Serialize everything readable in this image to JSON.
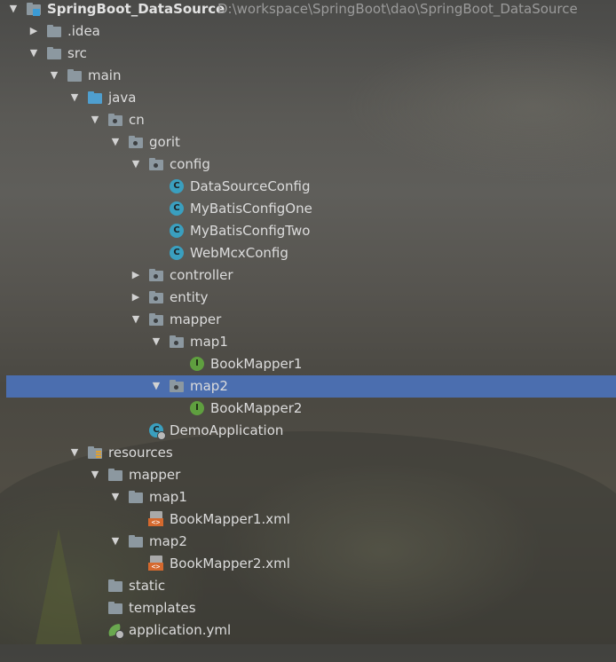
{
  "project": {
    "name": "SpringBoot_DataSource",
    "path": "D:\\workspace\\SpringBoot\\dao\\SpringBoot_DataSource"
  },
  "tree": [
    {
      "label": "SpringBoot_DataSource",
      "icon": "module-folder-icon",
      "expanded": true,
      "level": 0
    },
    {
      "label": ".idea",
      "icon": "folder-icon",
      "expanded": false,
      "level": 1
    },
    {
      "label": "src",
      "icon": "folder-icon",
      "expanded": true,
      "level": 1
    },
    {
      "label": "main",
      "icon": "folder-icon",
      "expanded": true,
      "level": 2
    },
    {
      "label": "java",
      "icon": "source-folder-icon",
      "expanded": true,
      "level": 3
    },
    {
      "label": "cn",
      "icon": "package-icon",
      "expanded": true,
      "level": 4
    },
    {
      "label": "gorit",
      "icon": "package-icon",
      "expanded": true,
      "level": 5
    },
    {
      "label": "config",
      "icon": "package-icon",
      "expanded": true,
      "level": 6
    },
    {
      "label": "DataSourceConfig",
      "icon": "class-icon",
      "level": 7
    },
    {
      "label": "MyBatisConfigOne",
      "icon": "class-icon",
      "level": 7
    },
    {
      "label": "MyBatisConfigTwo",
      "icon": "class-icon",
      "level": 7
    },
    {
      "label": "WebMcxConfig",
      "icon": "class-icon",
      "level": 7
    },
    {
      "label": "controller",
      "icon": "package-icon",
      "expanded": false,
      "level": 6
    },
    {
      "label": "entity",
      "icon": "package-icon",
      "expanded": false,
      "level": 6
    },
    {
      "label": "mapper",
      "icon": "package-icon",
      "expanded": true,
      "level": 6
    },
    {
      "label": "map1",
      "icon": "package-icon",
      "expanded": true,
      "level": 7
    },
    {
      "label": "BookMapper1",
      "icon": "interface-icon",
      "level": 8
    },
    {
      "label": "map2",
      "icon": "package-icon",
      "expanded": true,
      "level": 7,
      "selected": true
    },
    {
      "label": "BookMapper2",
      "icon": "interface-icon",
      "level": 8
    },
    {
      "label": "DemoApplication",
      "icon": "spring-boot-app-icon",
      "level": 6
    },
    {
      "label": "resources",
      "icon": "resources-folder-icon",
      "expanded": true,
      "level": 3
    },
    {
      "label": "mapper",
      "icon": "folder-icon",
      "expanded": true,
      "level": 4
    },
    {
      "label": "map1",
      "icon": "folder-icon",
      "expanded": true,
      "level": 5
    },
    {
      "label": "BookMapper1.xml",
      "icon": "xml-file-icon",
      "level": 6
    },
    {
      "label": "map2",
      "icon": "folder-icon",
      "expanded": true,
      "level": 5
    },
    {
      "label": "BookMapper2.xml",
      "icon": "xml-file-icon",
      "level": 6
    },
    {
      "label": "static",
      "icon": "folder-icon",
      "level": 4
    },
    {
      "label": "templates",
      "icon": "folder-icon",
      "level": 4
    },
    {
      "label": "application.yml",
      "icon": "yaml-file-icon",
      "level": 4
    }
  ],
  "colors": {
    "selection": "#4b6eaf",
    "text": "#dcdcdc",
    "path_text": "#9b9b9b"
  }
}
